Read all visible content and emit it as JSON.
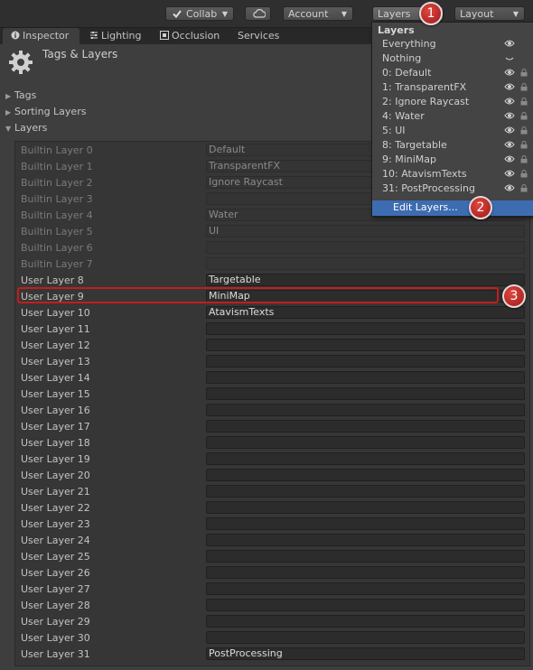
{
  "toolbar": {
    "collab_label": "Collab",
    "account_label": "Account",
    "layers_label": "Layers",
    "layout_label": "Layout"
  },
  "tabs": [
    {
      "label": "Inspector",
      "icon": "info-icon"
    },
    {
      "label": "Lighting",
      "icon": "lighting-icon"
    },
    {
      "label": "Occlusion",
      "icon": "occlusion-icon"
    },
    {
      "label": "Services",
      "icon": ""
    }
  ],
  "inspector": {
    "title": "Tags & Layers",
    "foldouts": [
      "Tags",
      "Sorting Layers",
      "Layers"
    ]
  },
  "layers": [
    {
      "label": "Builtin Layer 0",
      "value": "Default"
    },
    {
      "label": "Builtin Layer 1",
      "value": "TransparentFX"
    },
    {
      "label": "Builtin Layer 2",
      "value": "Ignore Raycast"
    },
    {
      "label": "Builtin Layer 3",
      "value": ""
    },
    {
      "label": "Builtin Layer 4",
      "value": "Water"
    },
    {
      "label": "Builtin Layer 5",
      "value": "UI"
    },
    {
      "label": "Builtin Layer 6",
      "value": ""
    },
    {
      "label": "Builtin Layer 7",
      "value": ""
    },
    {
      "label": "User Layer 8",
      "value": "Targetable"
    },
    {
      "label": "User Layer 9",
      "value": "MiniMap"
    },
    {
      "label": "User Layer 10",
      "value": "AtavismTexts"
    },
    {
      "label": "User Layer 11",
      "value": ""
    },
    {
      "label": "User Layer 12",
      "value": ""
    },
    {
      "label": "User Layer 13",
      "value": ""
    },
    {
      "label": "User Layer 14",
      "value": ""
    },
    {
      "label": "User Layer 15",
      "value": ""
    },
    {
      "label": "User Layer 16",
      "value": ""
    },
    {
      "label": "User Layer 17",
      "value": ""
    },
    {
      "label": "User Layer 18",
      "value": ""
    },
    {
      "label": "User Layer 19",
      "value": ""
    },
    {
      "label": "User Layer 20",
      "value": ""
    },
    {
      "label": "User Layer 21",
      "value": ""
    },
    {
      "label": "User Layer 22",
      "value": ""
    },
    {
      "label": "User Layer 23",
      "value": ""
    },
    {
      "label": "User Layer 24",
      "value": ""
    },
    {
      "label": "User Layer 25",
      "value": ""
    },
    {
      "label": "User Layer 26",
      "value": ""
    },
    {
      "label": "User Layer 27",
      "value": ""
    },
    {
      "label": "User Layer 28",
      "value": ""
    },
    {
      "label": "User Layer 29",
      "value": ""
    },
    {
      "label": "User Layer 30",
      "value": ""
    },
    {
      "label": "User Layer 31",
      "value": "PostProcessing"
    }
  ],
  "layers_dropdown": {
    "header": "Layers",
    "items": [
      {
        "label": "Everything",
        "eye": true,
        "lock": false
      },
      {
        "label": "Nothing",
        "eye": true,
        "lock": false
      },
      {
        "label": "0: Default",
        "eye": true,
        "lock": true
      },
      {
        "label": "1: TransparentFX",
        "eye": true,
        "lock": true
      },
      {
        "label": "2: Ignore Raycast",
        "eye": true,
        "lock": true
      },
      {
        "label": "4: Water",
        "eye": true,
        "lock": true
      },
      {
        "label": "5: UI",
        "eye": true,
        "lock": true
      },
      {
        "label": "8: Targetable",
        "eye": true,
        "lock": true
      },
      {
        "label": "9: MiniMap",
        "eye": true,
        "lock": true
      },
      {
        "label": "10: AtavismTexts",
        "eye": true,
        "lock": true
      },
      {
        "label": "31: PostProcessing",
        "eye": true,
        "lock": true
      }
    ],
    "edit_label": "Edit Layers..."
  },
  "callouts": [
    "1",
    "2",
    "3"
  ],
  "colors": {
    "highlight": "#c21d1d",
    "selection": "#3d6cb0",
    "badge": "#c0302a"
  }
}
